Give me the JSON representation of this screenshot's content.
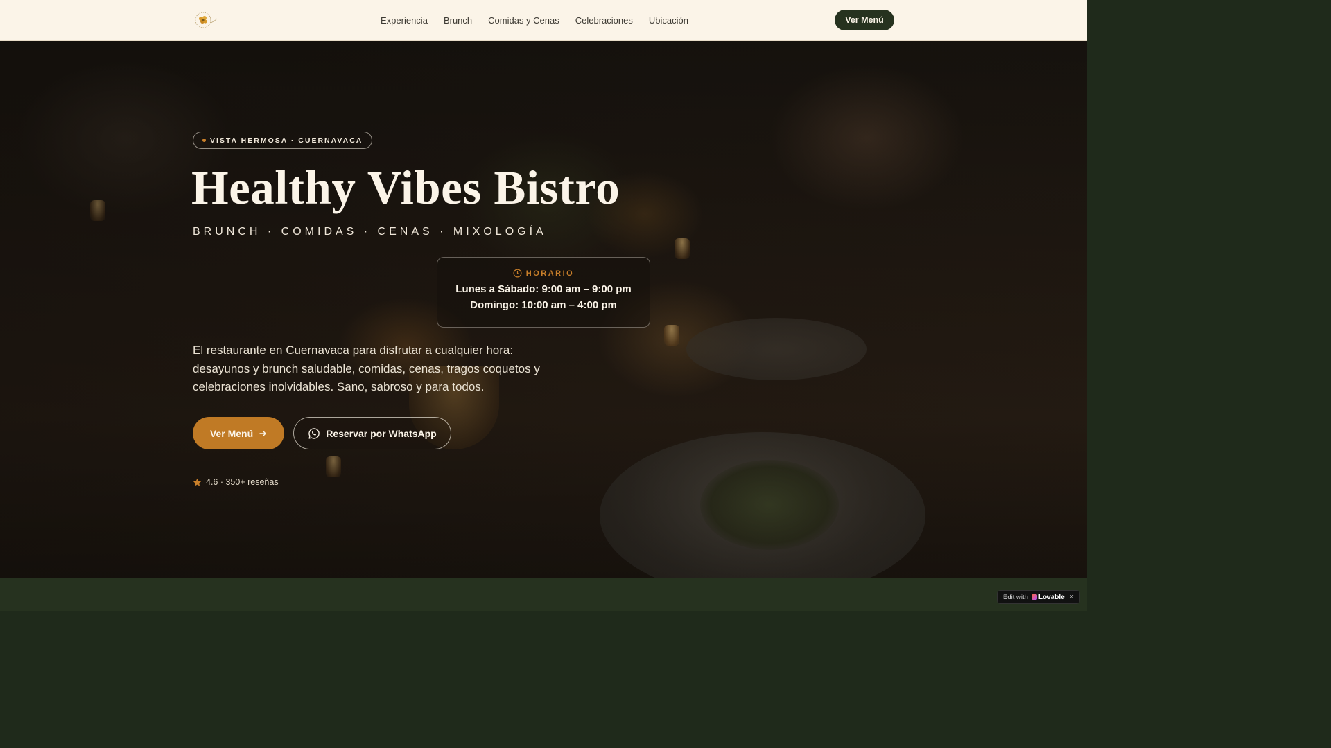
{
  "nav": {
    "logo_icon": "sunflower-logo-icon",
    "links": [
      "Experiencia",
      "Brunch",
      "Comidas y Cenas",
      "Celebraciones",
      "Ubicación"
    ],
    "cta_label": "Ver Menú"
  },
  "hero": {
    "badge": "VISTA HERMOSA · CUERNAVACA",
    "title": "Healthy Vibes Bistro",
    "subtitle": "BRUNCH · COMIDAS · CENAS · MIXOLOGÍA",
    "hours": {
      "label": "HORARIO",
      "icon": "clock-icon",
      "line1": "Lunes a Sábado: 9:00 am – 9:00 pm",
      "line2": "Domingo: 10:00 am – 4:00 pm"
    },
    "description": "El restaurante en Cuernavaca para disfrutar a cualquier hora: desayunos y brunch saludable, comidas, cenas, tragos coquetos y celebraciones inolvidables. Sano, sabroso y para todos.",
    "primary_button": "Ver Menú",
    "primary_button_icon": "arrow-right-icon",
    "secondary_button": "Reservar por WhatsApp",
    "secondary_button_icon": "whatsapp-icon",
    "rating_text": "4.6 · 350+ reseñas",
    "rating_icon": "star-icon"
  },
  "lovable": {
    "prefix": "Edit with",
    "brand": "Lovable",
    "close": "×"
  },
  "colors": {
    "nav_bg": "#fbf4e8",
    "accent": "#c07a25",
    "dark_green": "#26321f",
    "cream": "#fbf4e8"
  }
}
